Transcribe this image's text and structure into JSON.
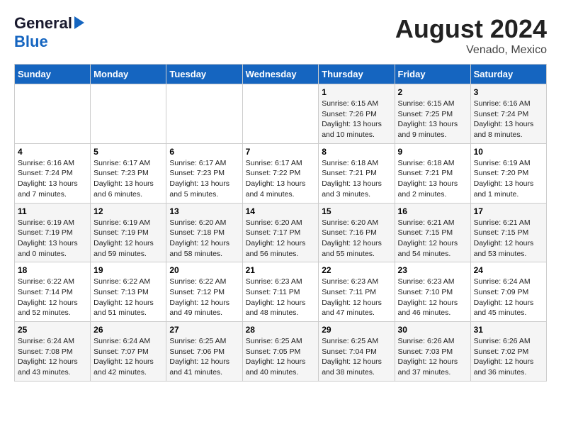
{
  "header": {
    "logo_general": "General",
    "logo_blue": "Blue",
    "title": "August 2024",
    "subtitle": "Venado, Mexico"
  },
  "days_of_week": [
    "Sunday",
    "Monday",
    "Tuesday",
    "Wednesday",
    "Thursday",
    "Friday",
    "Saturday"
  ],
  "weeks": [
    [
      {
        "num": "",
        "sunrise": "",
        "sunset": "",
        "daylight": ""
      },
      {
        "num": "",
        "sunrise": "",
        "sunset": "",
        "daylight": ""
      },
      {
        "num": "",
        "sunrise": "",
        "sunset": "",
        "daylight": ""
      },
      {
        "num": "",
        "sunrise": "",
        "sunset": "",
        "daylight": ""
      },
      {
        "num": "1",
        "sunrise": "Sunrise: 6:15 AM",
        "sunset": "Sunset: 7:26 PM",
        "daylight": "Daylight: 13 hours and 10 minutes."
      },
      {
        "num": "2",
        "sunrise": "Sunrise: 6:15 AM",
        "sunset": "Sunset: 7:25 PM",
        "daylight": "Daylight: 13 hours and 9 minutes."
      },
      {
        "num": "3",
        "sunrise": "Sunrise: 6:16 AM",
        "sunset": "Sunset: 7:24 PM",
        "daylight": "Daylight: 13 hours and 8 minutes."
      }
    ],
    [
      {
        "num": "4",
        "sunrise": "Sunrise: 6:16 AM",
        "sunset": "Sunset: 7:24 PM",
        "daylight": "Daylight: 13 hours and 7 minutes."
      },
      {
        "num": "5",
        "sunrise": "Sunrise: 6:17 AM",
        "sunset": "Sunset: 7:23 PM",
        "daylight": "Daylight: 13 hours and 6 minutes."
      },
      {
        "num": "6",
        "sunrise": "Sunrise: 6:17 AM",
        "sunset": "Sunset: 7:23 PM",
        "daylight": "Daylight: 13 hours and 5 minutes."
      },
      {
        "num": "7",
        "sunrise": "Sunrise: 6:17 AM",
        "sunset": "Sunset: 7:22 PM",
        "daylight": "Daylight: 13 hours and 4 minutes."
      },
      {
        "num": "8",
        "sunrise": "Sunrise: 6:18 AM",
        "sunset": "Sunset: 7:21 PM",
        "daylight": "Daylight: 13 hours and 3 minutes."
      },
      {
        "num": "9",
        "sunrise": "Sunrise: 6:18 AM",
        "sunset": "Sunset: 7:21 PM",
        "daylight": "Daylight: 13 hours and 2 minutes."
      },
      {
        "num": "10",
        "sunrise": "Sunrise: 6:19 AM",
        "sunset": "Sunset: 7:20 PM",
        "daylight": "Daylight: 13 hours and 1 minute."
      }
    ],
    [
      {
        "num": "11",
        "sunrise": "Sunrise: 6:19 AM",
        "sunset": "Sunset: 7:19 PM",
        "daylight": "Daylight: 13 hours and 0 minutes."
      },
      {
        "num": "12",
        "sunrise": "Sunrise: 6:19 AM",
        "sunset": "Sunset: 7:19 PM",
        "daylight": "Daylight: 12 hours and 59 minutes."
      },
      {
        "num": "13",
        "sunrise": "Sunrise: 6:20 AM",
        "sunset": "Sunset: 7:18 PM",
        "daylight": "Daylight: 12 hours and 58 minutes."
      },
      {
        "num": "14",
        "sunrise": "Sunrise: 6:20 AM",
        "sunset": "Sunset: 7:17 PM",
        "daylight": "Daylight: 12 hours and 56 minutes."
      },
      {
        "num": "15",
        "sunrise": "Sunrise: 6:20 AM",
        "sunset": "Sunset: 7:16 PM",
        "daylight": "Daylight: 12 hours and 55 minutes."
      },
      {
        "num": "16",
        "sunrise": "Sunrise: 6:21 AM",
        "sunset": "Sunset: 7:15 PM",
        "daylight": "Daylight: 12 hours and 54 minutes."
      },
      {
        "num": "17",
        "sunrise": "Sunrise: 6:21 AM",
        "sunset": "Sunset: 7:15 PM",
        "daylight": "Daylight: 12 hours and 53 minutes."
      }
    ],
    [
      {
        "num": "18",
        "sunrise": "Sunrise: 6:22 AM",
        "sunset": "Sunset: 7:14 PM",
        "daylight": "Daylight: 12 hours and 52 minutes."
      },
      {
        "num": "19",
        "sunrise": "Sunrise: 6:22 AM",
        "sunset": "Sunset: 7:13 PM",
        "daylight": "Daylight: 12 hours and 51 minutes."
      },
      {
        "num": "20",
        "sunrise": "Sunrise: 6:22 AM",
        "sunset": "Sunset: 7:12 PM",
        "daylight": "Daylight: 12 hours and 49 minutes."
      },
      {
        "num": "21",
        "sunrise": "Sunrise: 6:23 AM",
        "sunset": "Sunset: 7:11 PM",
        "daylight": "Daylight: 12 hours and 48 minutes."
      },
      {
        "num": "22",
        "sunrise": "Sunrise: 6:23 AM",
        "sunset": "Sunset: 7:11 PM",
        "daylight": "Daylight: 12 hours and 47 minutes."
      },
      {
        "num": "23",
        "sunrise": "Sunrise: 6:23 AM",
        "sunset": "Sunset: 7:10 PM",
        "daylight": "Daylight: 12 hours and 46 minutes."
      },
      {
        "num": "24",
        "sunrise": "Sunrise: 6:24 AM",
        "sunset": "Sunset: 7:09 PM",
        "daylight": "Daylight: 12 hours and 45 minutes."
      }
    ],
    [
      {
        "num": "25",
        "sunrise": "Sunrise: 6:24 AM",
        "sunset": "Sunset: 7:08 PM",
        "daylight": "Daylight: 12 hours and 43 minutes."
      },
      {
        "num": "26",
        "sunrise": "Sunrise: 6:24 AM",
        "sunset": "Sunset: 7:07 PM",
        "daylight": "Daylight: 12 hours and 42 minutes."
      },
      {
        "num": "27",
        "sunrise": "Sunrise: 6:25 AM",
        "sunset": "Sunset: 7:06 PM",
        "daylight": "Daylight: 12 hours and 41 minutes."
      },
      {
        "num": "28",
        "sunrise": "Sunrise: 6:25 AM",
        "sunset": "Sunset: 7:05 PM",
        "daylight": "Daylight: 12 hours and 40 minutes."
      },
      {
        "num": "29",
        "sunrise": "Sunrise: 6:25 AM",
        "sunset": "Sunset: 7:04 PM",
        "daylight": "Daylight: 12 hours and 38 minutes."
      },
      {
        "num": "30",
        "sunrise": "Sunrise: 6:26 AM",
        "sunset": "Sunset: 7:03 PM",
        "daylight": "Daylight: 12 hours and 37 minutes."
      },
      {
        "num": "31",
        "sunrise": "Sunrise: 6:26 AM",
        "sunset": "Sunset: 7:02 PM",
        "daylight": "Daylight: 12 hours and 36 minutes."
      }
    ]
  ]
}
